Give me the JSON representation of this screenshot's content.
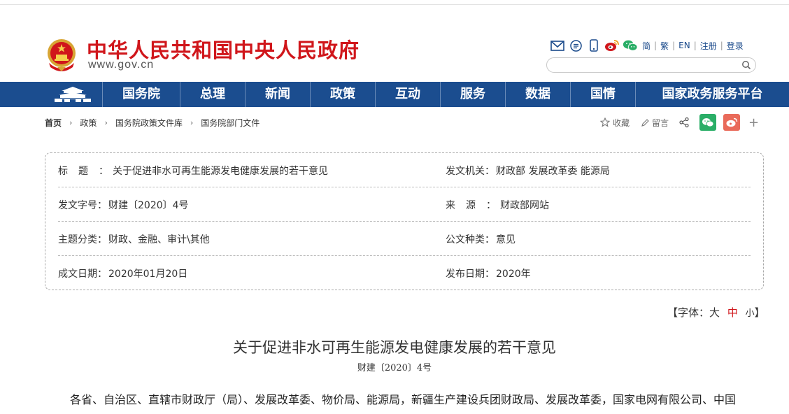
{
  "header": {
    "site_title": "中华人民共和国中央人民政府",
    "site_url": "www.gov.cn",
    "lang_links": [
      "简",
      "繁",
      "EN",
      "注册",
      "登录"
    ]
  },
  "nav": {
    "items": [
      "国务院",
      "总理",
      "新闻",
      "政策",
      "互动",
      "服务",
      "数据",
      "国情",
      "国家政务服务平台"
    ]
  },
  "breadcrumb": [
    "首页",
    "政策",
    "国务院政策文件库",
    "国务院部门文件"
  ],
  "share": {
    "favorite": "收藏",
    "comment": "留言",
    "plus": "+"
  },
  "info": {
    "title_label": "标题：",
    "title_value": "关于促进非水可再生能源发电健康发展的若干意见",
    "issuer_label": "发文机关：",
    "issuer_value": "财政部 发展改革委 能源局",
    "doc_no_label": "发文字号：",
    "doc_no_value": "财建〔2020〕4号",
    "source_label": "来源：",
    "source_value": "财政部网站",
    "topic_label": "主题分类：",
    "topic_value": "财政、金融、审计\\其他",
    "type_label": "公文种类：",
    "type_value": "意见",
    "date_label": "成文日期：",
    "date_value": "2020年01月20日",
    "pub_label": "发布日期：",
    "pub_value": "2020年"
  },
  "font_ctrl": {
    "prefix": "【字体：",
    "large": "大",
    "medium": "中",
    "small": "小",
    "suffix": "】"
  },
  "article": {
    "title": "关于促进非水可再生能源发电健康发展的若干意见",
    "doc_number": "财建〔2020〕4号",
    "body_line1": "各省、自治区、直辖市财政厅（局）、发展改革委、物价局、能源局，新疆生产建设兵团财政局、发展改革委，国家电网有限公司、中国"
  },
  "colors": {
    "brand_red": "#d0161b",
    "nav_blue": "#1b4d8f",
    "link_blue": "#1a4a8b"
  }
}
